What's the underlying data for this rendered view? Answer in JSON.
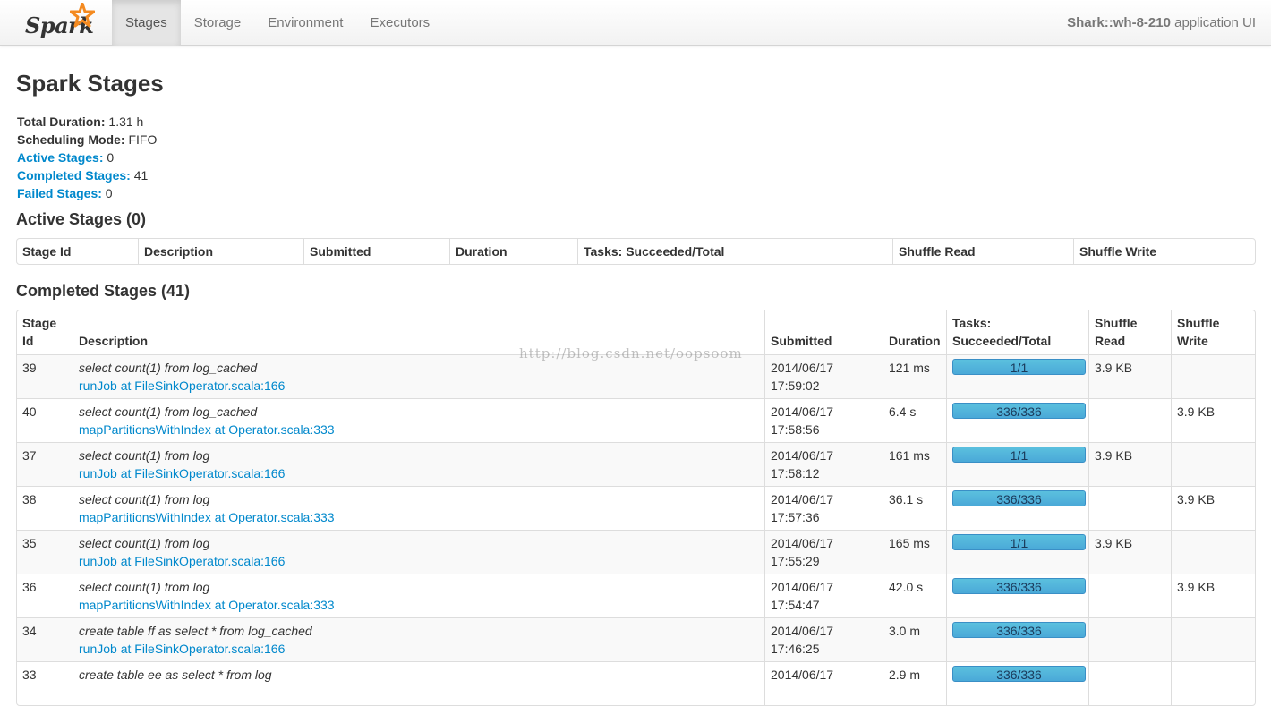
{
  "navbar": {
    "brand": "Spark",
    "tabs": [
      {
        "label": "Stages",
        "active": true
      },
      {
        "label": "Storage",
        "active": false
      },
      {
        "label": "Environment",
        "active": false
      },
      {
        "label": "Executors",
        "active": false
      }
    ],
    "app_name": "Shark::wh-8-210",
    "app_suffix": " application UI"
  },
  "page": {
    "title": "Spark Stages",
    "summary": {
      "total_duration_label": "Total Duration:",
      "total_duration": " 1.31 h",
      "scheduling_mode_label": "Scheduling Mode:",
      "scheduling_mode": " FIFO",
      "active_stages_label": "Active Stages:",
      "active_stages": " 0",
      "completed_stages_label": "Completed Stages:",
      "completed_stages": " 41",
      "failed_stages_label": "Failed Stages:",
      "failed_stages": " 0"
    }
  },
  "active": {
    "heading": "Active Stages (0)",
    "headers": [
      "Stage Id",
      "Description",
      "Submitted",
      "Duration",
      "Tasks: Succeeded/Total",
      "Shuffle Read",
      "Shuffle Write"
    ]
  },
  "completed": {
    "heading": "Completed Stages (41)",
    "headers": {
      "stage_id": [
        "Stage",
        "Id"
      ],
      "description": "Description",
      "submitted": "Submitted",
      "duration": "Duration",
      "tasks": [
        "Tasks:",
        "Succeeded/Total"
      ],
      "shuffle_read": [
        "Shuffle",
        "Read"
      ],
      "shuffle_write": [
        "Shuffle",
        "Write"
      ]
    },
    "rows": [
      {
        "id": "39",
        "query": "select count(1) from log_cached",
        "job": "runJob at FileSinkOperator.scala:166",
        "date": "2014/06/17",
        "time": "17:59:02",
        "duration": "121 ms",
        "tasks": "1/1",
        "progress": 1.0,
        "read": "3.9 KB",
        "write": ""
      },
      {
        "id": "40",
        "query": "select count(1) from log_cached",
        "job": "mapPartitionsWithIndex at Operator.scala:333",
        "date": "2014/06/17",
        "time": "17:58:56",
        "duration": "6.4 s",
        "tasks": "336/336",
        "progress": 1.0,
        "read": "",
        "write": "3.9 KB"
      },
      {
        "id": "37",
        "query": "select count(1) from log",
        "job": "runJob at FileSinkOperator.scala:166",
        "date": "2014/06/17",
        "time": "17:58:12",
        "duration": "161 ms",
        "tasks": "1/1",
        "progress": 1.0,
        "read": "3.9 KB",
        "write": ""
      },
      {
        "id": "38",
        "query": "select count(1) from log",
        "job": "mapPartitionsWithIndex at Operator.scala:333",
        "date": "2014/06/17",
        "time": "17:57:36",
        "duration": "36.1 s",
        "tasks": "336/336",
        "progress": 1.0,
        "read": "",
        "write": "3.9 KB"
      },
      {
        "id": "35",
        "query": "select count(1) from log",
        "job": "runJob at FileSinkOperator.scala:166",
        "date": "2014/06/17",
        "time": "17:55:29",
        "duration": "165 ms",
        "tasks": "1/1",
        "progress": 1.0,
        "read": "3.9 KB",
        "write": ""
      },
      {
        "id": "36",
        "query": "select count(1) from log",
        "job": "mapPartitionsWithIndex at Operator.scala:333",
        "date": "2014/06/17",
        "time": "17:54:47",
        "duration": "42.0 s",
        "tasks": "336/336",
        "progress": 1.0,
        "read": "",
        "write": "3.9 KB"
      },
      {
        "id": "34",
        "query": "create table ff as select * from log_cached",
        "job": "runJob at FileSinkOperator.scala:166",
        "date": "2014/06/17",
        "time": "17:46:25",
        "duration": "3.0 m",
        "tasks": "336/336",
        "progress": 1.0,
        "read": "",
        "write": ""
      },
      {
        "id": "33",
        "query": "create table ee as select * from log",
        "job": "",
        "date": "2014/06/17",
        "time": "",
        "duration": "2.9 m",
        "tasks": "336/336",
        "progress": 1.0,
        "read": "",
        "write": ""
      }
    ]
  },
  "watermark": "http://blog.csdn.net/oopsoom",
  "colors": {
    "link": "#0088cc",
    "progress": "#5bc0de",
    "brand_star": "#f48a20"
  },
  "icons": {
    "brand_logo": "spark-star-icon"
  }
}
